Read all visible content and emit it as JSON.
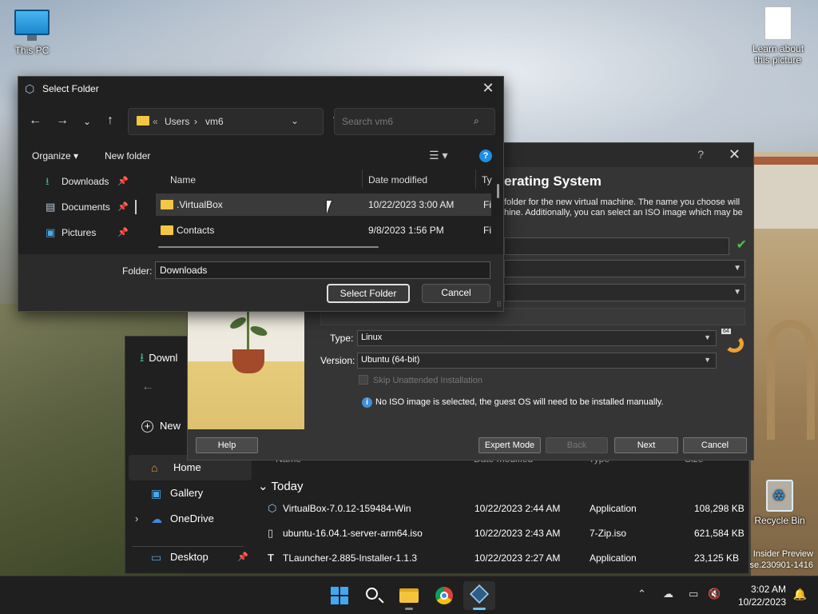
{
  "desktop": {
    "icons": [
      {
        "label": "This PC"
      },
      {
        "label": "Learn about\nthis picture"
      },
      {
        "label": "Recycle Bin"
      }
    ],
    "watermark_line1": "Insider Preview",
    "watermark_line2": "se.230901-1416"
  },
  "explorer": {
    "title": "Downl",
    "new_label": "New",
    "sidebar": [
      {
        "label": "Home",
        "icon": "home-icon"
      },
      {
        "label": "Gallery",
        "icon": "gallery-icon"
      },
      {
        "label": "OneDrive",
        "icon": "cloud-icon"
      },
      {
        "label": "Desktop",
        "icon": "desktop-icon"
      }
    ],
    "headers": {
      "name": "Name",
      "date": "Date modified",
      "type": "Type",
      "size": "Size"
    },
    "group": "Today",
    "rows": [
      {
        "name": "VirtualBox-7.0.12-159484-Win",
        "date": "10/22/2023 2:44 AM",
        "type": "Application",
        "size": "108,298 KB"
      },
      {
        "name": "ubuntu-16.04.1-server-arm64.iso",
        "date": "10/22/2023 2:43 AM",
        "type": "7-Zip.iso",
        "size": "621,584 KB"
      },
      {
        "name": "TLauncher-2.885-Installer-1.1.3",
        "date": "10/22/2023 2:27 AM",
        "type": "Application",
        "size": "23,125 KB"
      }
    ]
  },
  "vbox": {
    "help_q": "?",
    "heading": "erating System",
    "desc": "folder for the new virtual machine. The name you choose will\nhine. Additionally, you can select an ISO image which may be",
    "type_label": "Type:",
    "type_value": "Linux",
    "version_label": "Version:",
    "version_value": "Ubuntu (64-bit)",
    "skip_label": "Skip Unattended Installation",
    "info_text": "No ISO image is selected, the guest OS will need to be installed manually.",
    "buttons": {
      "help": "Help",
      "expert": "Expert Mode",
      "back": "Back",
      "next": "Next",
      "cancel": "Cancel"
    },
    "os_badge": "64"
  },
  "dialog": {
    "title": "Select Folder",
    "breadcrumb": [
      "«",
      "Users",
      "›",
      "vm6"
    ],
    "search_placeholder": "Search vm6",
    "organize": "Organize ▾",
    "new_folder": "New folder",
    "help_glyph": "?",
    "sidebar": [
      {
        "label": "Downloads",
        "icon": "download-icon"
      },
      {
        "label": "Documents",
        "icon": "documents-icon"
      },
      {
        "label": "Pictures",
        "icon": "pictures-icon"
      }
    ],
    "columns": {
      "name": "Name",
      "date": "Date modified",
      "type": "Ty"
    },
    "rows": [
      {
        "name": ".VirtualBox",
        "date": "10/22/2023 3:00 AM",
        "type": "Fi",
        "selected": true
      },
      {
        "name": "Contacts",
        "date": "9/8/2023 1:56 PM",
        "type": "Fi",
        "selected": false
      }
    ],
    "folder_label": "Folder:",
    "folder_value": "Downloads",
    "select_button": "Select Folder",
    "cancel_button": "Cancel"
  },
  "taskbar": {
    "apps": [
      "start",
      "search",
      "file-explorer",
      "chrome",
      "virtualbox"
    ],
    "time": "3:02 AM",
    "date": "10/22/2023"
  },
  "colors": {
    "accent": "#1c8ee6",
    "folder": "#f3c643",
    "ok_check": "#4ec04a"
  }
}
